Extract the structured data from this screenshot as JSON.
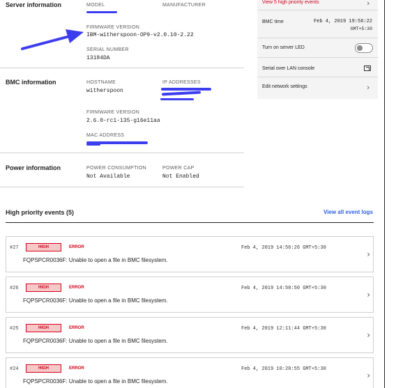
{
  "server": {
    "title": "Server information",
    "model_label": "MODEL",
    "manufacturer_label": "MANUFACTURER",
    "firmware_label": "FIRMWARE VERSION",
    "firmware_value": "IBM-witherspoon-OP9-v2.0.10-2.22",
    "serial_label": "SERIAL NUMBER",
    "serial_value": "13184DA"
  },
  "bmc": {
    "title": "BMC information",
    "hostname_label": "HOSTNAME",
    "hostname_value": "witherspoon",
    "ip_label": "IP ADDRESSES",
    "firmware_label": "FIRMWARE VERSION",
    "firmware_value": "2.6.0-rc1-135-g16e11aa",
    "mac_label": "MAC ADDRESS"
  },
  "power": {
    "title": "Power information",
    "consumption_label": "POWER CONSUMPTION",
    "consumption_value": "Not Available",
    "cap_label": "POWER CAP",
    "cap_value": "Not Enabled"
  },
  "panel": {
    "high_priority_link": "View 5 high priority events",
    "bmc_time_label": "BMC time",
    "bmc_time_value": "Feb 4, 2019 19:56:22",
    "bmc_time_zone": "GMT+5:30",
    "led_label": "Turn on server LED",
    "sol_label": "Serial over LAN console",
    "network_label": "Edit network settings"
  },
  "events": {
    "title": "High priority events (5)",
    "view_all": "View all event logs",
    "items": [
      {
        "id": "#27",
        "severity": "HIGH",
        "type": "ERROR",
        "time": "Feb 4, 2019 14:56:26 GMT+5:30",
        "desc": "FQPSPCR0036F: Unable to open a file in BMC filesystem."
      },
      {
        "id": "#26",
        "severity": "HIGH",
        "type": "ERROR",
        "time": "Feb 4, 2019 14:50:50 GMT+5:30",
        "desc": "FQPSPCR0036F: Unable to open a file in BMC filesystem."
      },
      {
        "id": "#25",
        "severity": "HIGH",
        "type": "ERROR",
        "time": "Feb 4, 2019 12:11:44 GMT+5:30",
        "desc": "FQPSPCR0036F: Unable to open a file in BMC filesystem."
      },
      {
        "id": "#24",
        "severity": "HIGH",
        "type": "ERROR",
        "time": "Feb 4, 2019 10:20:55 GMT+5:30",
        "desc": "FQPSPCR0036F: Unable to open a file in BMC filesystem."
      }
    ]
  },
  "colors": {
    "accent_blue": "#2d60e5",
    "error_red": "#d0021b",
    "annotation_blue": "#3d3df0"
  },
  "icons": [
    "chevron-right-icon",
    "toggle-switch",
    "external-link-icon",
    "annotation-arrow"
  ]
}
